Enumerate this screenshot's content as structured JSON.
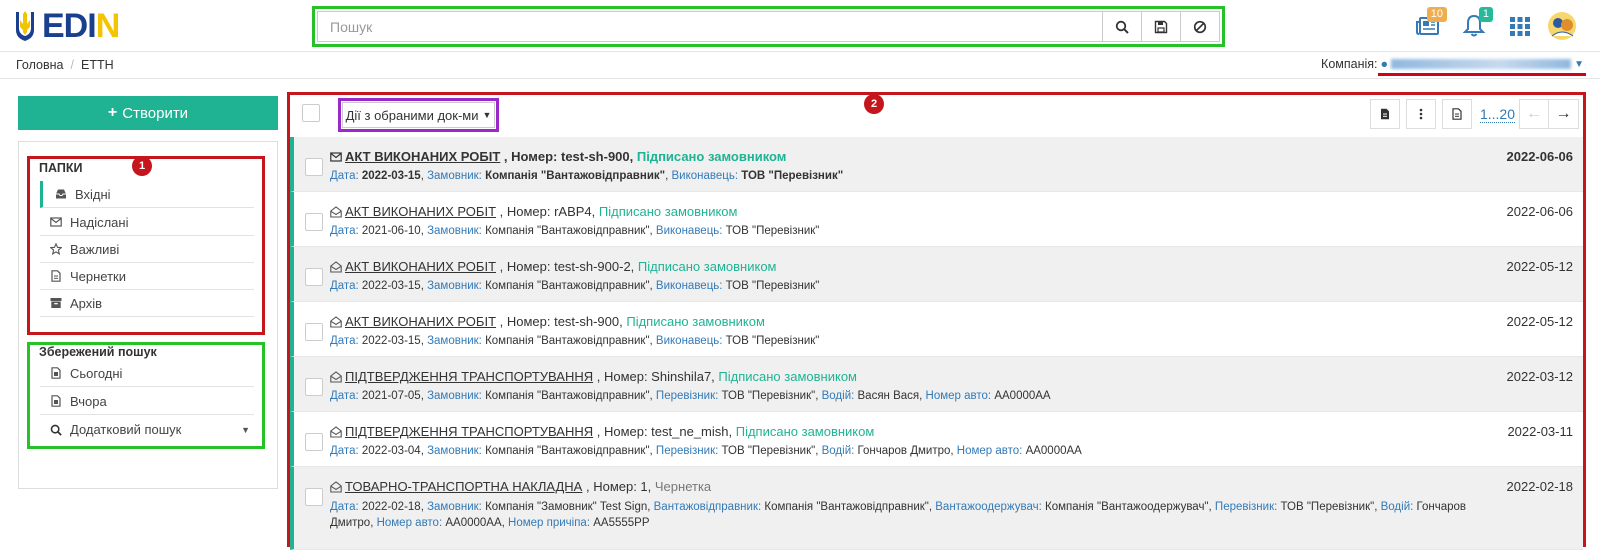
{
  "header": {
    "logo_text": "EDIN",
    "search_placeholder": "Пошук",
    "news_badge": "10",
    "notif_badge": "1"
  },
  "breadcrumb": [
    "Головна",
    "ЕТТН"
  ],
  "company": {
    "label": "Компанія:"
  },
  "sidebar": {
    "create_label": "Створити",
    "folders_title": "ПАПКИ",
    "folders": [
      {
        "label": "Вхідні",
        "icon": "inbox-icon"
      },
      {
        "label": "Надіслані",
        "icon": "envelope-icon"
      },
      {
        "label": "Важливі",
        "icon": "star-icon"
      },
      {
        "label": "Чернетки",
        "icon": "draft-icon"
      },
      {
        "label": "Архів",
        "icon": "archive-icon"
      }
    ],
    "saved_title": "Збережений пошук",
    "saved": [
      {
        "label": "Сьогодні"
      },
      {
        "label": "Вчора"
      },
      {
        "label": "Додатковий пошук"
      }
    ],
    "marker": "1"
  },
  "main": {
    "marker": "2",
    "actions_label": "Дії з обраними док-ми",
    "pager": "1...20",
    "docs": [
      {
        "title": "АКТ ВИКОНАНИХ РОБІТ",
        "number": " , Номер: test-sh-900, ",
        "status": "Підписано замовником",
        "date": "2022-06-06",
        "details": [
          [
            "Дата:",
            "2022-03-15"
          ],
          [
            "Замовник:",
            "Компанія \"Вантажовідправник\""
          ],
          [
            "Виконавець:",
            "ТОВ \"Перевізник\""
          ]
        ]
      },
      {
        "title": "АКТ ВИКОНАНИХ РОБІТ",
        "number": " , Номер: rABP4, ",
        "status": "Підписано замовником",
        "date": "2022-06-06",
        "details": [
          [
            "Дата:",
            "2021-06-10"
          ],
          [
            "Замовник:",
            "Компанія \"Вантажовідправник\""
          ],
          [
            "Виконавець:",
            "ТОВ \"Перевізник\""
          ]
        ]
      },
      {
        "title": "АКТ ВИКОНАНИХ РОБІТ",
        "number": " , Номер: test-sh-900-2, ",
        "status": "Підписано замовником",
        "date": "2022-05-12",
        "details": [
          [
            "Дата:",
            "2022-03-15"
          ],
          [
            "Замовник:",
            "Компанія \"Вантажовідправник\""
          ],
          [
            "Виконавець:",
            "ТОВ \"Перевізник\""
          ]
        ]
      },
      {
        "title": "АКТ ВИКОНАНИХ РОБІТ",
        "number": " , Номер: test-sh-900, ",
        "status": "Підписано замовником",
        "date": "2022-05-12",
        "details": [
          [
            "Дата:",
            "2022-03-15"
          ],
          [
            "Замовник:",
            "Компанія \"Вантажовідправник\""
          ],
          [
            "Виконавець:",
            "ТОВ \"Перевізник\""
          ]
        ]
      },
      {
        "title": "ПІДТВЕРДЖЕННЯ ТРАНСПОРТУВАННЯ",
        "number": " , Номер: Shinshila7, ",
        "status": "Підписано замовником",
        "date": "2022-03-12",
        "details": [
          [
            "Дата:",
            "2021-07-05"
          ],
          [
            "Замовник:",
            "Компанія \"Вантажовідправник\""
          ],
          [
            "Перевізник:",
            "ТОВ \"Перевізник\""
          ],
          [
            "Водій:",
            "Васян Вася"
          ],
          [
            "Номер авто:",
            "AA0000AA"
          ]
        ]
      },
      {
        "title": "ПІДТВЕРДЖЕННЯ ТРАНСПОРТУВАННЯ",
        "number": " , Номер: test_ne_mish, ",
        "status": "Підписано замовником",
        "date": "2022-03-11",
        "details": [
          [
            "Дата:",
            "2022-03-04"
          ],
          [
            "Замовник:",
            "Компанія \"Вантажовідправник\""
          ],
          [
            "Перевізник:",
            "ТОВ \"Перевізник\""
          ],
          [
            "Водій:",
            "Гончаров Дмитро"
          ],
          [
            "Номер авто:",
            "AA0000AA"
          ]
        ]
      },
      {
        "title": "ТОВАРНО-ТРАНСПОРТНА НАКЛАДНА",
        "number": " , Номер: 1, ",
        "status": "Чернетка",
        "date": "2022-02-18",
        "details": [
          [
            "Дата:",
            "2022-02-18"
          ],
          [
            "Замовник:",
            "Компанія \"Замовник\" Test Sign"
          ],
          [
            "Вантажовідправник:",
            "Компанія \"Вантажовідправник\""
          ],
          [
            "Вантажоодержувач:",
            "Компанія \"Вантажоодержувач\""
          ],
          [
            "Перевізник:",
            "ТОВ \"Перевізник\""
          ],
          [
            "Водій:",
            "Гончаров Дмитро"
          ],
          [
            "Номер авто:",
            "AA0000AA"
          ],
          [
            "Номер причіпа:",
            "AA5555PP"
          ]
        ]
      }
    ]
  }
}
